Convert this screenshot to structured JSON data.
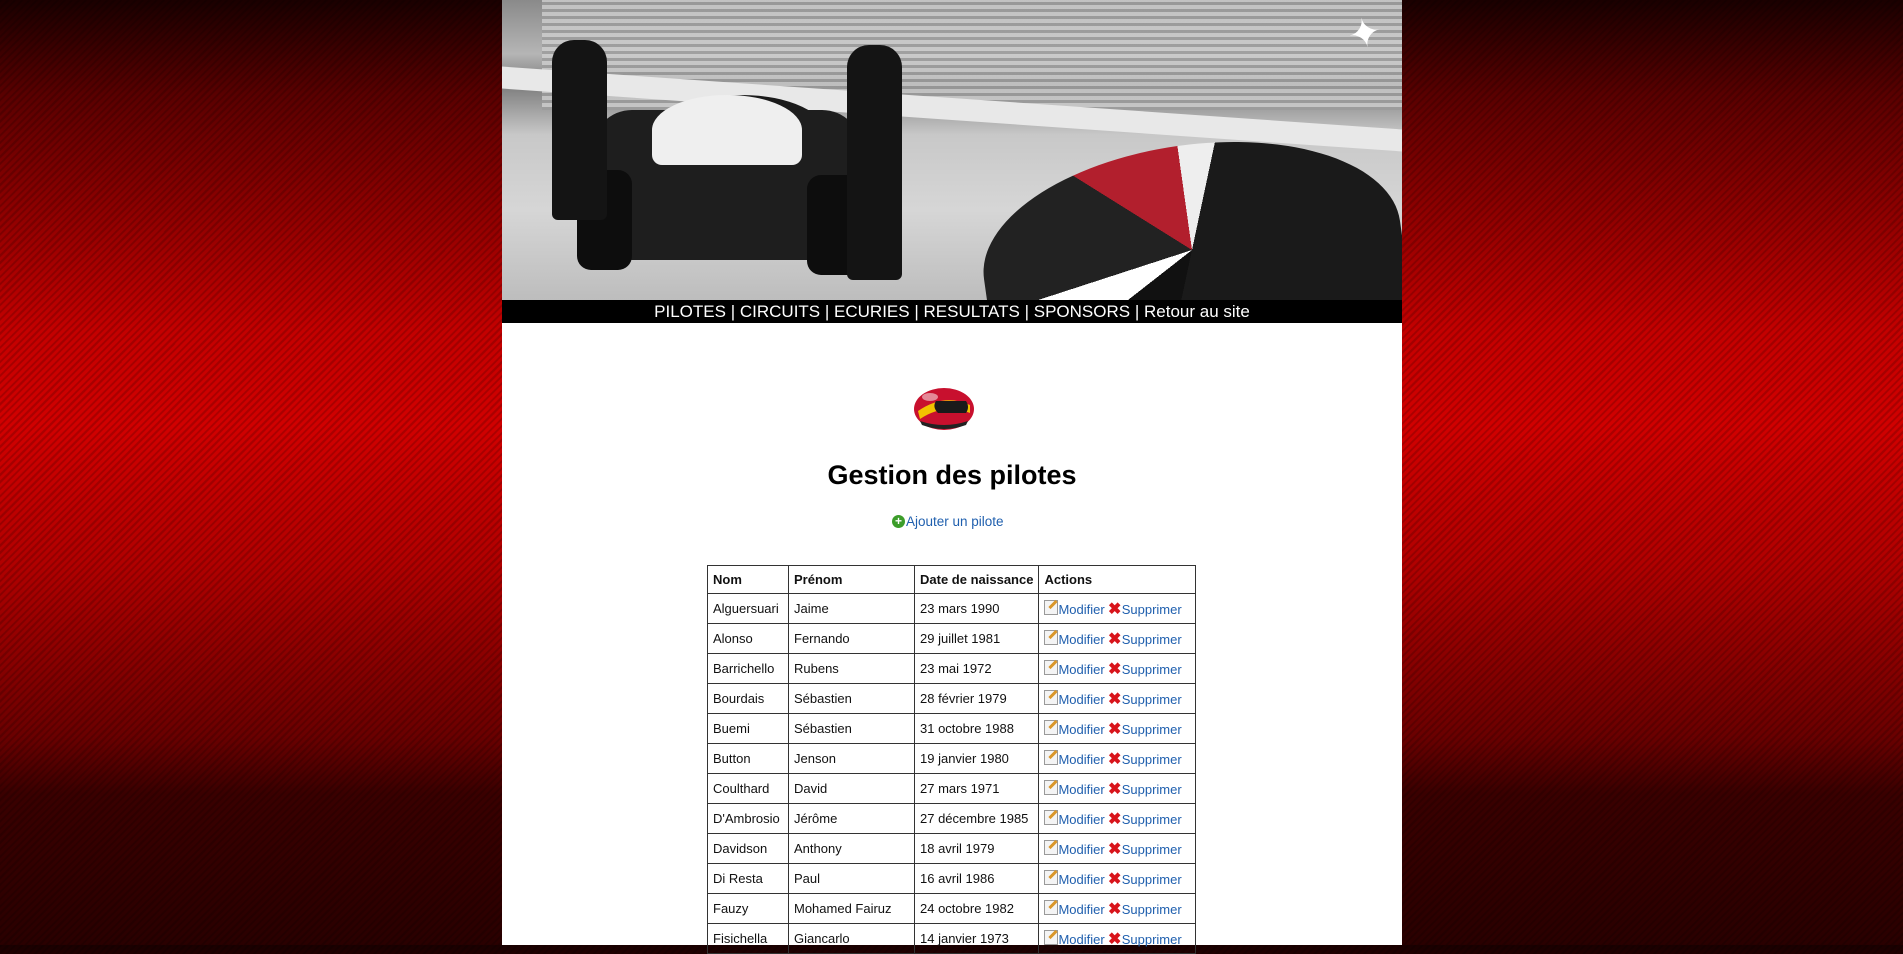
{
  "nav": {
    "items": [
      "PILOTES",
      "CIRCUITS",
      "ECURIES",
      "RESULTATS",
      "SPONSORS",
      "Retour au site"
    ],
    "separator": "|"
  },
  "banner": {
    "logo_icon": "alpinestars-star-logo"
  },
  "page": {
    "title": "Gestion des pilotes",
    "add_link": "Ajouter un pilote"
  },
  "table": {
    "headers": [
      "Nom",
      "Prénom",
      "Date de naissance",
      "Actions"
    ],
    "edit_label": "Modifier",
    "delete_label": "Supprimer",
    "rows": [
      [
        "Alguersuari",
        "Jaime",
        "23 mars 1990"
      ],
      [
        "Alonso",
        "Fernando",
        "29 juillet 1981"
      ],
      [
        "Barrichello",
        "Rubens",
        "23 mai 1972"
      ],
      [
        "Bourdais",
        "Sébastien",
        "28 février 1979"
      ],
      [
        "Buemi",
        "Sébastien",
        "31 octobre 1988"
      ],
      [
        "Button",
        "Jenson",
        "19 janvier 1980"
      ],
      [
        "Coulthard",
        "David",
        "27 mars 1971"
      ],
      [
        "D'Ambrosio",
        "Jérôme",
        "27 décembre 1985"
      ],
      [
        "Davidson",
        "Anthony",
        "18 avril 1979"
      ],
      [
        "Di Resta",
        "Paul",
        "16 avril 1986"
      ],
      [
        "Fauzy",
        "Mohamed Fairuz",
        "24 octobre 1982"
      ],
      [
        "Fisichella",
        "Giancarlo",
        "14 janvier 1973"
      ]
    ]
  },
  "colors": {
    "link": "#1f5fae",
    "navbar": "#000000",
    "delete": "#d8141b",
    "add": "#3c9d2a"
  }
}
